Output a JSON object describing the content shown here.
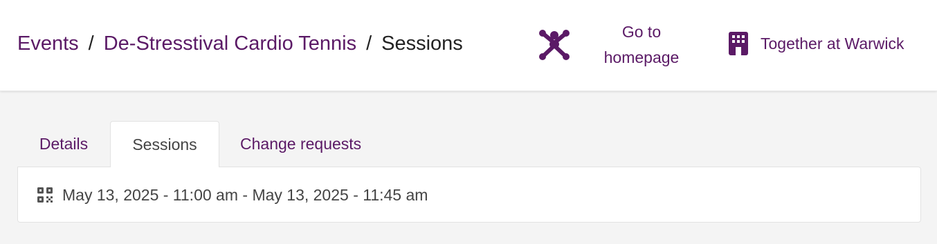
{
  "header": {
    "breadcrumb": {
      "items": [
        "Events",
        "De-Stresstival Cardio Tennis"
      ],
      "separator": "/",
      "current": "Sessions"
    },
    "home_link": {
      "label_line1": "Go to",
      "label_line2": "homepage",
      "icon": "person-star-icon"
    },
    "org_link": {
      "label": "Together at Warwick",
      "icon": "building-icon"
    }
  },
  "tabs": [
    {
      "label": "Details",
      "active": false
    },
    {
      "label": "Sessions",
      "active": true
    },
    {
      "label": "Change requests",
      "active": false
    }
  ],
  "sessions": [
    {
      "icon": "qr-code-icon",
      "text": "May 13, 2025 - 11:00 am - May 13, 2025 - 11:45 am"
    }
  ],
  "colors": {
    "brand": "#5b1a66",
    "page_bg": "#f4f4f4",
    "surface": "#ffffff",
    "text": "#222222",
    "muted_text": "#444444"
  }
}
